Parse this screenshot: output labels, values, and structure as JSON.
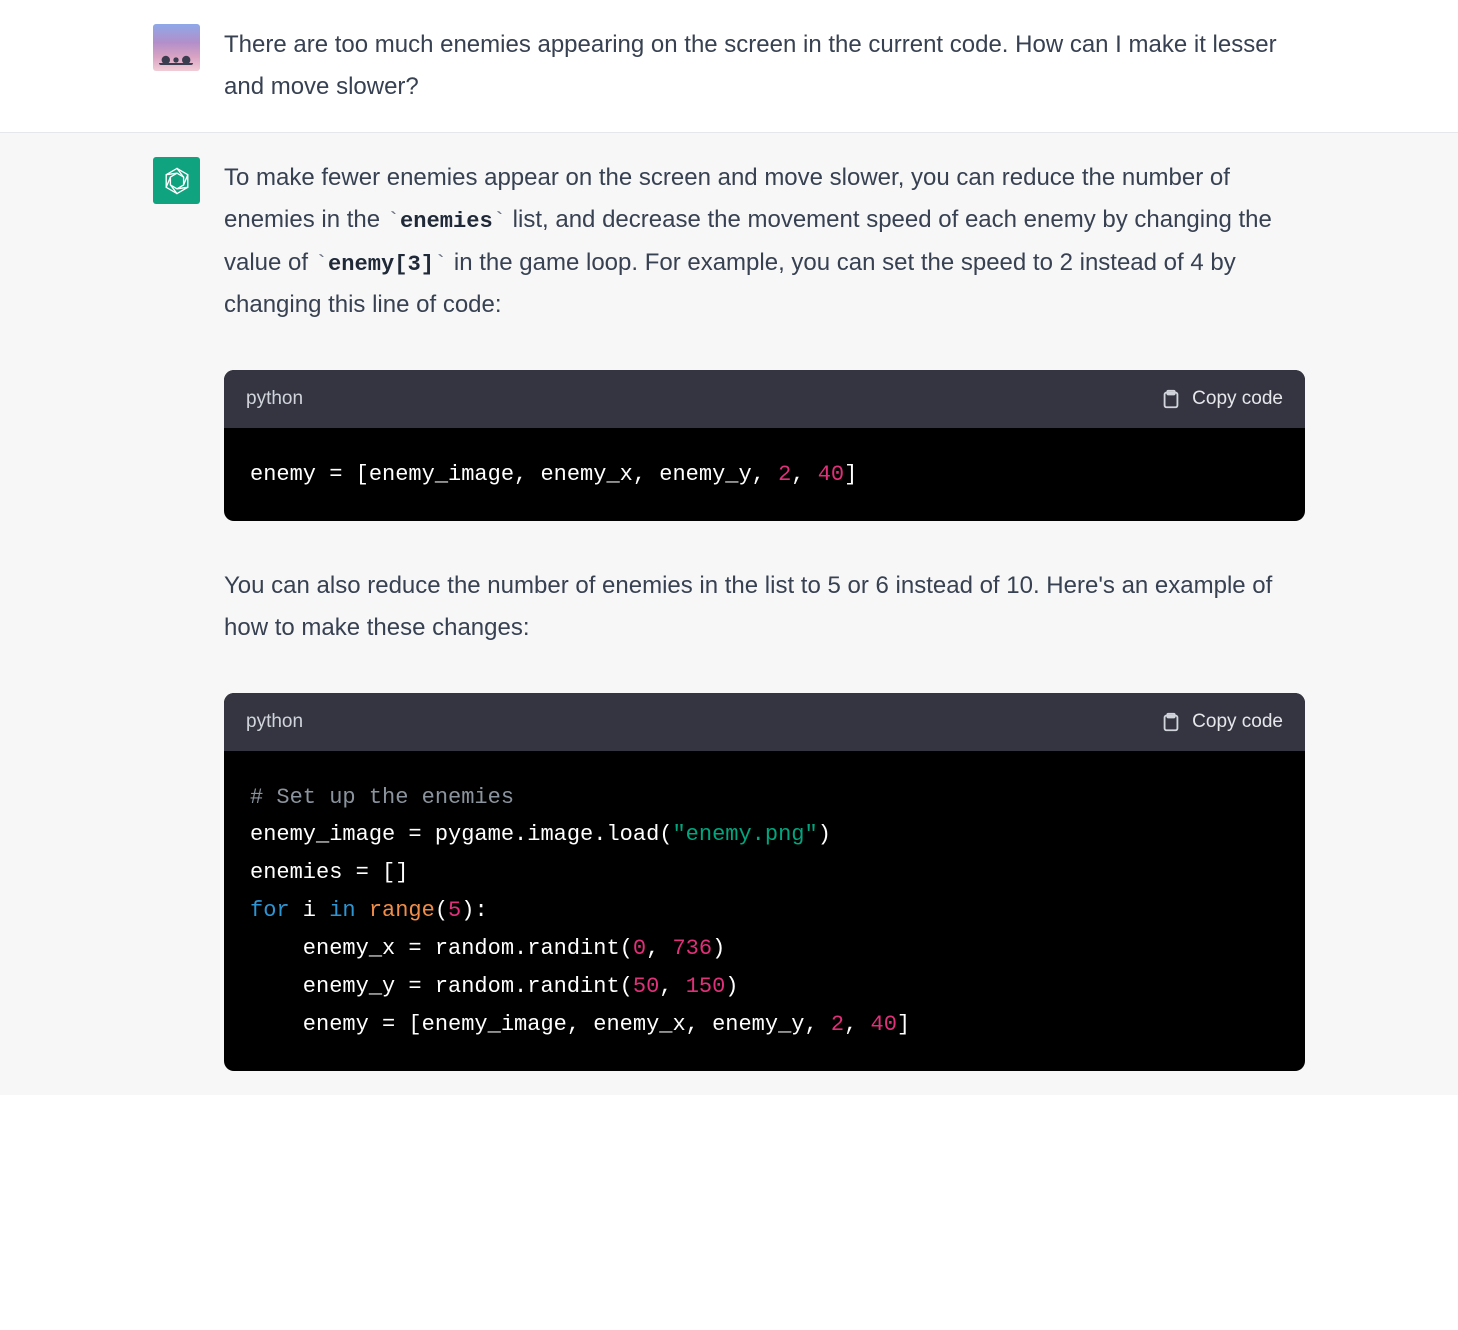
{
  "user": {
    "question": "There are too much enemies appearing on the screen in the current code. How can I make it lesser and move slower?"
  },
  "assistant": {
    "intro_before_code1": "To make fewer enemies appear on the screen and move slower, you can reduce the number of enemies in the ",
    "inline1": "enemies",
    "intro_mid": " list, and decrease the movement speed of each enemy by changing the value of ",
    "inline2": "enemy[3]",
    "intro_after": " in the game loop. For example, you can set the speed to 2 instead of 4 by changing this line of code:",
    "between_code": "You can also reduce the number of enemies in the list to 5 or 6 instead of 10. Here's an example of how to make these changes:",
    "code_lang": "python",
    "copy_label": "Copy code",
    "code1": {
      "plain": "enemy = [enemy_image, enemy_x, enemy_y, ",
      "n1": "2",
      "comma": ", ",
      "n2": "40",
      "close": "]"
    },
    "code2": {
      "c_comment": "# Set up the enemies",
      "l2a": "enemy_image = pygame.image.load(",
      "l2str": "\"enemy.png\"",
      "l2b": ")",
      "l3": "enemies = []",
      "l4a": "for",
      "l4b": " i ",
      "l4c": "in",
      "l4d": " ",
      "l4fn": "range",
      "l4e": "(",
      "l4n": "5",
      "l4f": "):",
      "l5a": "    enemy_x = random.randint(",
      "l5n1": "0",
      "l5c": ", ",
      "l5n2": "736",
      "l5b": ")",
      "l6a": "    enemy_y = random.randint(",
      "l6n1": "50",
      "l6c": ", ",
      "l6n2": "150",
      "l6b": ")",
      "l7a": "    enemy = [enemy_image, enemy_x, enemy_y, ",
      "l7n1": "2",
      "l7c": ", ",
      "l7n2": "40",
      "l7b": "]"
    }
  }
}
